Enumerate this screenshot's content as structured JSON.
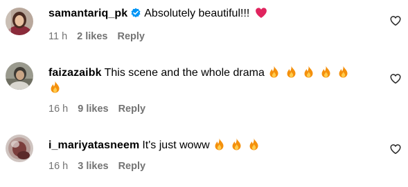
{
  "comments": [
    {
      "username": "samantariq_pk",
      "verified": true,
      "text": "Absolutely beautiful!!!",
      "time": "11 h",
      "likes": "2 likes",
      "reply": "Reply"
    },
    {
      "username": "faizazaibk",
      "verified": false,
      "text": "This scene and the whole drama",
      "time": "16 h",
      "likes": "9 likes",
      "reply": "Reply"
    },
    {
      "username": "i_mariyatasneem",
      "verified": false,
      "text": "It's just woww",
      "time": "16 h",
      "likes": "3 likes",
      "reply": "Reply"
    }
  ],
  "icons": {
    "verified": "verified-badge-icon",
    "red_heart": "red-heart-emoji",
    "fire": "fire-emoji",
    "like": "heart-outline-icon"
  },
  "colors": {
    "verified_blue": "#0095f6",
    "meta_gray": "#737373",
    "heart_red": "#e0245e",
    "fire_orange": "#f4900c"
  }
}
